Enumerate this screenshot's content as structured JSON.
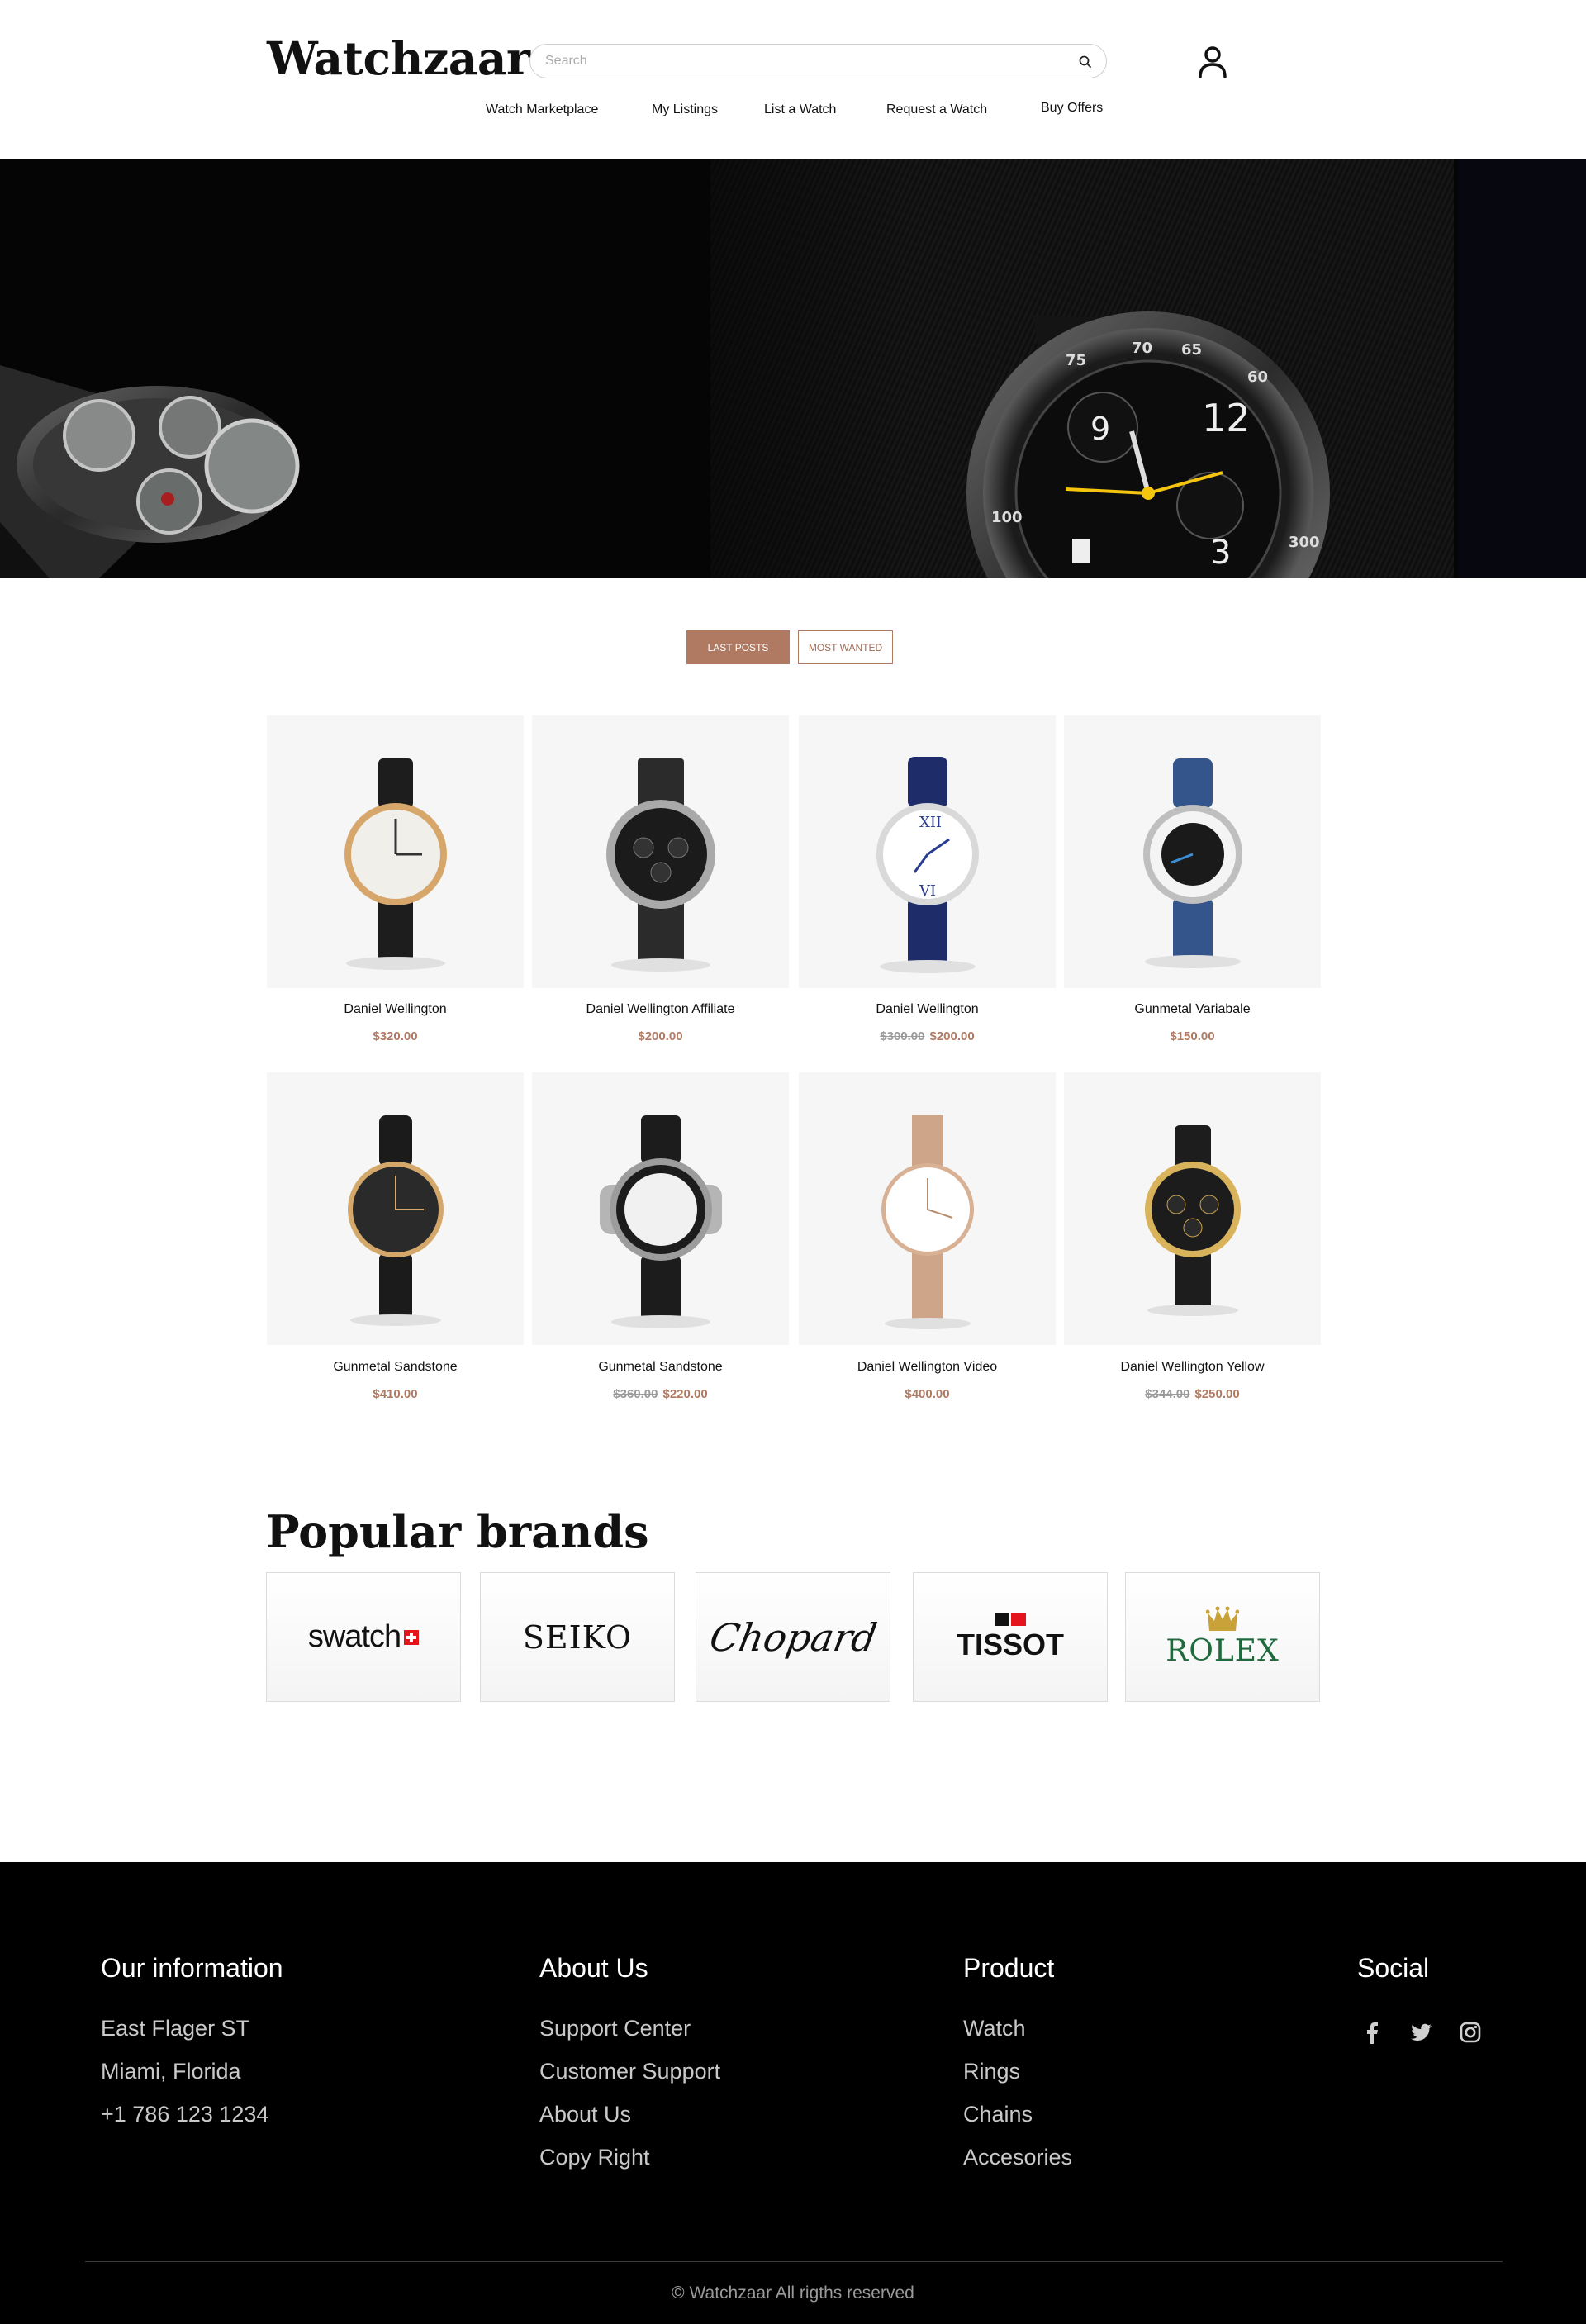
{
  "header": {
    "logo": "Watchzaar",
    "search_placeholder": "Search",
    "nav": [
      "Watch Marketplace",
      "My Listings",
      "List a Watch",
      "Request a Watch",
      "Buy Offers"
    ]
  },
  "tabs": {
    "active": "LAST POSTS",
    "inactive": "MOST WANTED"
  },
  "products": [
    {
      "name": "Daniel Wellington",
      "old_price": "",
      "price": "$320.00"
    },
    {
      "name": "Daniel Wellington Affiliate",
      "old_price": "",
      "price": "$200.00"
    },
    {
      "name": "Daniel Wellington",
      "old_price": "$300.00",
      "price": "$200.00"
    },
    {
      "name": "Gunmetal Variabale",
      "old_price": "",
      "price": "$150.00"
    },
    {
      "name": "Gunmetal Sandstone",
      "old_price": "",
      "price": "$410.00"
    },
    {
      "name": "Gunmetal Sandstone",
      "old_price": "$360.00",
      "price": "$220.00"
    },
    {
      "name": "Daniel Wellington Video",
      "old_price": "",
      "price": "$400.00"
    },
    {
      "name": "Daniel Wellington Yellow",
      "old_price": "$344.00",
      "price": "$250.00"
    }
  ],
  "brands_section": {
    "title": "Popular brands",
    "brands": [
      "swatch",
      "SEIKO",
      "Chopard",
      "TISSOT",
      "ROLEX"
    ]
  },
  "footer": {
    "columns": [
      {
        "title": "Our information",
        "items": [
          "East Flager ST",
          "Miami, Florida",
          "+1 786 123 1234"
        ]
      },
      {
        "title": "About Us",
        "items": [
          "Support Center",
          "Customer Support",
          "About Us",
          "Copy Right"
        ]
      },
      {
        "title": "Product",
        "items": [
          "Watch",
          "Rings",
          "Chains",
          "Accesories"
        ]
      },
      {
        "title": "Social",
        "items": []
      }
    ],
    "social_icons": [
      "facebook-icon",
      "twitter-icon",
      "instagram-icon"
    ],
    "copyright": "© Watchzaar All rigths reserved"
  },
  "colors": {
    "accent": "#b07a62",
    "footer_bg": "#000000",
    "card_bg": "#f6f6f6"
  }
}
